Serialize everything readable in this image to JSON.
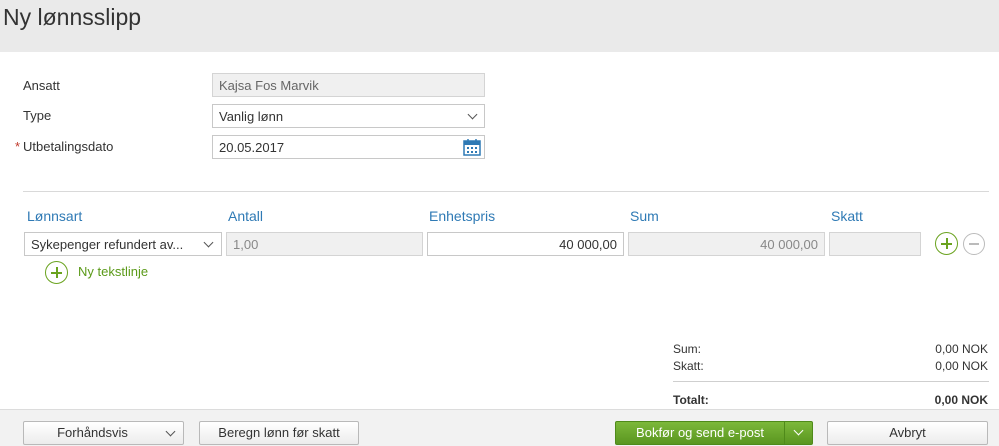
{
  "header": {
    "title": "Ny lønnsslipp"
  },
  "form": {
    "employee": {
      "label": "Ansatt",
      "value": "Kajsa Fos Marvik"
    },
    "type": {
      "label": "Type",
      "value": "Vanlig lønn"
    },
    "payment_date": {
      "label": "Utbetalingsdato",
      "required_mark": "*",
      "value": "20.05.2017"
    }
  },
  "lines": {
    "columns": [
      "Lønnsart",
      "Antall",
      "Enhetspris",
      "Sum",
      "Skatt"
    ],
    "rows": [
      {
        "wage_type": "Sykepenger refundert av...",
        "quantity": "1,00",
        "unit_price": "40 000,00",
        "sum": "40 000,00",
        "tax": ""
      }
    ],
    "add_text_line": "Ny tekstlinje"
  },
  "summary": {
    "sum_label": "Sum:",
    "sum_value": "0,00 NOK",
    "tax_label": "Skatt:",
    "tax_value": "0,00 NOK",
    "total_label": "Totalt:",
    "total_value": "0,00 NOK"
  },
  "footer": {
    "preview_label": "Forhåndsvis",
    "calc_label": "Beregn lønn før skatt",
    "post_label": "Bokfør og send e-post",
    "cancel_label": "Avbryt"
  },
  "colors": {
    "accent_green": "#5a9620",
    "link_blue": "#2f7ab5",
    "required_red": "#c0392b"
  }
}
